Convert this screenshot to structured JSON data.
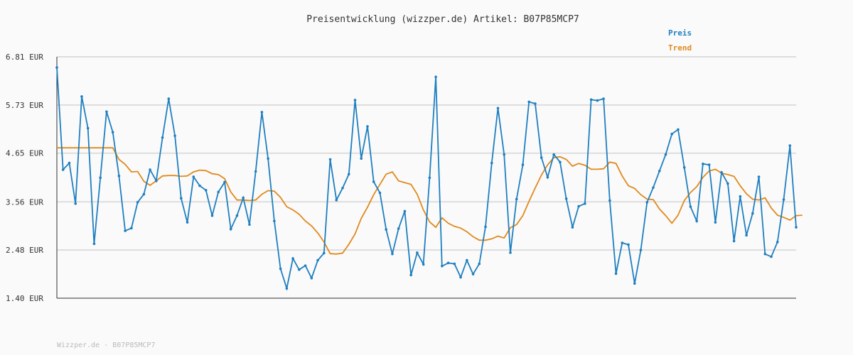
{
  "title": "Preisentwicklung (wizzper.de) Artikel: B07P85MCP7",
  "footer": "Wizzper.de - B07P85MCP7",
  "colors": {
    "preis": "#1f7fc0",
    "trend": "#e08a1e",
    "grid": "#dddddd",
    "axis": "#333333"
  },
  "chart_data": {
    "type": "line",
    "title": "Preisentwicklung (wizzper.de) Artikel: B07P85MCP7",
    "xlabel": "",
    "ylabel": "",
    "ylim": [
      1.4,
      6.81
    ],
    "yticks": [
      "6.81 EUR",
      "5.73 EUR",
      "4.65 EUR",
      "3.56 EUR",
      "2.48 EUR",
      "1.40 EUR"
    ],
    "ytick_values": [
      6.81,
      5.73,
      4.65,
      3.56,
      2.48,
      1.4
    ],
    "grid": true,
    "legend": "top-right",
    "series": [
      {
        "name": "Preis",
        "color": "#1f7fc0",
        "values": [
          6.57,
          4.28,
          4.43,
          3.52,
          5.92,
          5.21,
          2.62,
          4.1,
          5.58,
          5.12,
          4.14,
          2.91,
          2.97,
          3.55,
          3.73,
          4.28,
          4.03,
          5.0,
          5.87,
          5.04,
          3.64,
          3.1,
          4.12,
          3.92,
          3.82,
          3.25,
          3.78,
          4.0,
          2.95,
          3.25,
          3.65,
          3.05,
          4.24,
          5.57,
          4.53,
          3.13,
          2.06,
          1.62,
          2.29,
          2.04,
          2.13,
          1.85,
          2.25,
          2.41,
          4.51,
          3.6,
          3.87,
          4.18,
          5.84,
          4.53,
          5.25,
          4.01,
          3.76,
          2.94,
          2.39,
          2.96,
          3.35,
          1.92,
          2.42,
          2.16,
          4.1,
          6.36,
          2.12,
          2.19,
          2.17,
          1.87,
          2.25,
          1.94,
          2.17,
          3.0,
          4.43,
          5.66,
          4.62,
          2.42,
          3.62,
          4.39,
          5.8,
          5.76,
          4.55,
          4.11,
          4.62,
          4.45,
          3.63,
          2.99,
          3.46,
          3.52,
          5.85,
          5.83,
          5.87,
          3.59,
          1.95,
          2.64,
          2.6,
          1.73,
          2.48,
          3.55,
          3.88,
          4.25,
          4.62,
          5.08,
          5.18,
          4.33,
          3.45,
          3.13,
          4.41,
          4.39,
          3.1,
          4.22,
          3.97,
          2.68,
          3.68,
          2.81,
          3.3,
          4.12,
          2.39,
          2.33,
          2.66,
          3.61,
          4.82,
          2.99
        ]
      },
      {
        "name": "Trend",
        "color": "#e08a1e",
        "values": [
          4.77,
          4.77,
          4.77,
          4.77,
          4.77,
          4.77,
          4.77,
          4.77,
          4.77,
          4.77,
          4.51,
          4.4,
          4.23,
          4.24,
          4.02,
          3.93,
          4.03,
          4.14,
          4.15,
          4.15,
          4.13,
          4.14,
          4.23,
          4.27,
          4.26,
          4.19,
          4.17,
          4.08,
          3.78,
          3.6,
          3.6,
          3.59,
          3.6,
          3.73,
          3.81,
          3.8,
          3.66,
          3.45,
          3.38,
          3.28,
          3.13,
          3.02,
          2.86,
          2.66,
          2.4,
          2.39,
          2.41,
          2.61,
          2.84,
          3.19,
          3.44,
          3.72,
          3.95,
          4.18,
          4.23,
          4.03,
          3.99,
          3.95,
          3.73,
          3.38,
          3.11,
          2.99,
          3.2,
          3.08,
          3.01,
          2.97,
          2.89,
          2.78,
          2.7,
          2.7,
          2.73,
          2.79,
          2.75,
          2.98,
          3.05,
          3.25,
          3.57,
          3.87,
          4.16,
          4.39,
          4.55,
          4.57,
          4.51,
          4.36,
          4.42,
          4.38,
          4.29,
          4.29,
          4.3,
          4.45,
          4.42,
          4.14,
          3.92,
          3.86,
          3.72,
          3.62,
          3.61,
          3.4,
          3.25,
          3.08,
          3.26,
          3.59,
          3.77,
          3.9,
          4.11,
          4.25,
          4.29,
          4.2,
          4.17,
          4.13,
          3.92,
          3.74,
          3.62,
          3.6,
          3.65,
          3.42,
          3.26,
          3.21,
          3.15,
          3.25,
          3.26
        ]
      }
    ]
  }
}
